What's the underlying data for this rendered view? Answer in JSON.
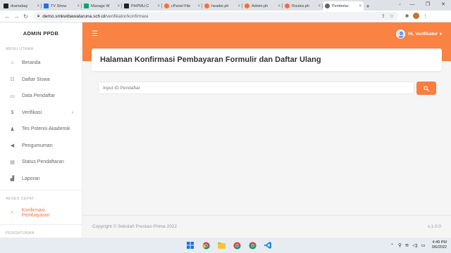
{
  "browser": {
    "tabs": [
      {
        "label": "dramabay",
        "color": "#202124"
      },
      {
        "label": "TV Show",
        "color": "#1a73e8"
      },
      {
        "label": "Manage W",
        "color": "#0aa66e"
      },
      {
        "label": "PHPMU.C",
        "color": "#202124"
      },
      {
        "label": "cPanel File",
        "color": "#ff6c2c"
      },
      {
        "label": "header.ph",
        "color": "#ff6c2c"
      },
      {
        "label": "Admin.ph",
        "color": "#ff6c2c"
      },
      {
        "label": "Routes.ph",
        "color": "#ff6c2c"
      },
      {
        "label": "Pembelar",
        "color": "#5f6368"
      }
    ],
    "address": {
      "host": "demo.smkwibawataruna.sch.id",
      "path": "/verifikator/konfirmasi"
    }
  },
  "sidebar": {
    "brand": "ADMIN PPDB",
    "menu_utama_label": "MENU UTAMA",
    "items": [
      {
        "label": "Beranda",
        "icon": "home-icon",
        "glyph": "⌂"
      },
      {
        "label": "Daftar Siswa",
        "icon": "users-icon",
        "glyph": "☷"
      },
      {
        "label": "Data Pendaftar",
        "icon": "folder-icon",
        "glyph": "▭"
      },
      {
        "label": "Verifikasi",
        "icon": "dollar-icon",
        "glyph": "$"
      },
      {
        "label": "Tes Potensi Akademik",
        "icon": "user-check-icon",
        "glyph": "♟"
      },
      {
        "label": "Pengumuman",
        "icon": "megaphone-icon",
        "glyph": "◀"
      },
      {
        "label": "Status Pendaftaran",
        "icon": "edit-icon",
        "glyph": "▤"
      },
      {
        "label": "Laporan",
        "icon": "chart-icon",
        "glyph": "▟"
      }
    ],
    "akses_cepat_label": "AKSES CEPAT",
    "quick_item": {
      "label": "Konfirmasi Pembayaran",
      "icon": "search-icon",
      "glyph": "⌕"
    },
    "pengaturan_label": "PENGATURAN"
  },
  "header": {
    "user_label": "Hi, Verifikator"
  },
  "main": {
    "page_title": "Halaman Konfirmasi Pembayaran Formulir dan Daftar Ulang",
    "search_placeholder": "Input ID Pendaftar",
    "search_button_icon": "search-icon"
  },
  "footer": {
    "copyright": "Copyright © Sekolah Prestasi Prima 2022",
    "version": "v.1.0.0"
  },
  "taskbar": {
    "time": "4:49 PM",
    "date": "3/6/2022"
  },
  "colors": {
    "accent": "#fa8242",
    "active_nav": "#f9743b"
  }
}
